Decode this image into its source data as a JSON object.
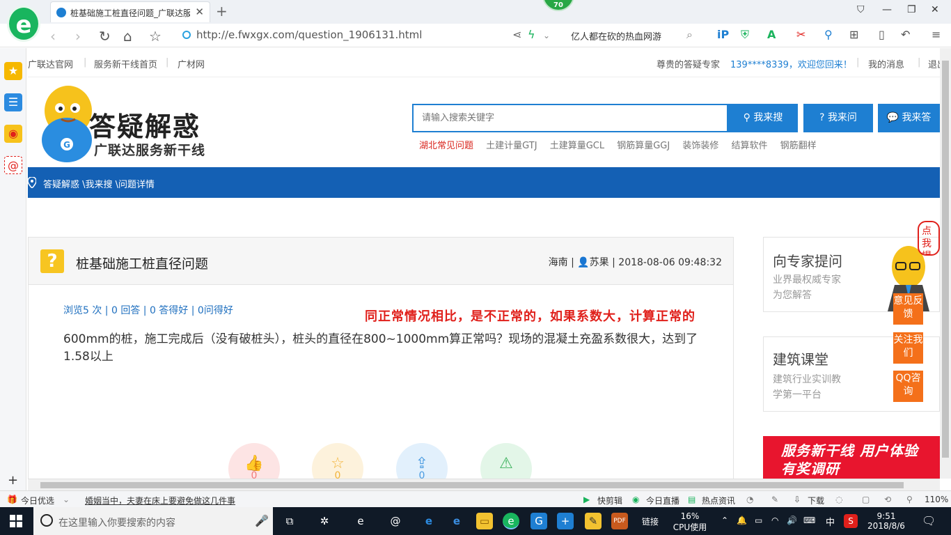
{
  "browser": {
    "logo_letter": "e",
    "tab_title": "桩基础施工桩直径问题_广联达服",
    "tab_close": "✕",
    "new_tab": "+",
    "score_badge": "70",
    "url": "http://e.fwxgx.com/question_1906131.html",
    "search_hot": "亿人都在砍的热血网游",
    "window_controls": {
      "minimize": "—",
      "restore": "❐",
      "close": "✕"
    }
  },
  "topnav": {
    "links": [
      "广联达官网",
      "服务新干线首页",
      "广材网"
    ],
    "welcome_prefix": "尊贵的答疑专家",
    "user_phone": "139****8339，欢迎您回来！",
    "messages": "我的消息",
    "logout": "退出"
  },
  "logo": {
    "title": "答疑解惑",
    "subtitle": "广联达服务新干线",
    "mascot_letter": "G"
  },
  "search": {
    "placeholder": "请输入搜索关键字",
    "btn_search": "我来搜",
    "btn_ask": "我来问",
    "btn_answer": "我来答",
    "hot_links": [
      "湖北常见问题",
      "土建计量GTJ",
      "土建算量GCL",
      "钢筋算量GGJ",
      "装饰装修",
      "结算软件",
      "钢筋翻样"
    ]
  },
  "breadcrumb": "答疑解惑 \\我来搜 \\问题详情",
  "question": {
    "title": "桩基础施工桩直径问题",
    "region": "海南",
    "author": "苏果",
    "datetime": "2018-08-06 09:48:32",
    "stats": "浏览5 次 | 0 回答 | 0 答得好 | 0问得好",
    "body": "600mm的桩，施工完成后（没有破桩头），桩头的直径在800~1000mm算正常吗？现场的混凝土充盈系数很大，达到了1.58以上",
    "counts": [
      "0",
      "0",
      "0"
    ]
  },
  "answer_overlay": "同正常情况相比，是不正常的，如果系数大，计算正常的",
  "right_column": {
    "expert": {
      "title": "向专家提问",
      "line1": "业界最权威专家",
      "line2": "为您解答",
      "bubble": "点我提问"
    },
    "course": {
      "title": "建筑课堂",
      "line1": "建筑行业实训教",
      "line2": "学第一平台"
    },
    "side_buttons": [
      "意见反馈",
      "关注我们",
      "QQ咨询"
    ],
    "banner": "服务新干线 用户体验有奖调研"
  },
  "statusbar": {
    "today_pick": "今日优选",
    "news": "婚姻当中，夫妻在床上要避免做这几件事",
    "quick_clip": "快剪辑",
    "today_live": "今日直播",
    "hot_news": "热点资讯",
    "download": "下载",
    "zoom": "110%"
  },
  "taskbar": {
    "search_placeholder": "在这里输入你要搜索的内容",
    "link_label": "链接",
    "cpu_percent": "16%",
    "cpu_label": "CPU使用",
    "ime": "中",
    "time": "9:51",
    "date": "2018/8/6"
  }
}
